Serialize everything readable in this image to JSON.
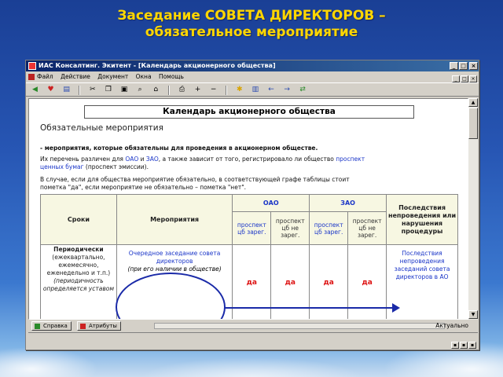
{
  "slide": {
    "title_line1": "Заседание СОВЕТА ДИРЕКТОРОВ –",
    "title_line2": "обязательное мероприятие"
  },
  "window": {
    "title": "ИАС Консалтинг. Экитент - [Календарь акционерного общества]",
    "controls": {
      "minimize": "_",
      "maximize": "□",
      "close": "×"
    }
  },
  "menu": {
    "items": [
      "Файл",
      "Действие",
      "Документ",
      "Окна",
      "Помощь"
    ]
  },
  "toolbar": {
    "icons": [
      "back-icon",
      "heart-icon",
      "bookmark-icon",
      "cut-icon",
      "copy-icon",
      "paste-icon",
      "find-icon",
      "home-icon",
      "print-icon",
      "zoom-in-icon",
      "zoom-out-icon",
      "lightbulb-icon",
      "chart-icon",
      "arrow-left-icon",
      "arrow-right-icon",
      "sync-icon"
    ]
  },
  "document": {
    "heading": "Календарь акционерного общества",
    "section_title": "Обязательные мероприятия",
    "intro_bold": "- мероприятия, которые обязательны для проведения в акционерном обществе.",
    "p1_a": "Их перечень различен для ",
    "p1_link1": "ОАО",
    "p1_b": " и ",
    "p1_link2": "ЗАО",
    "p1_c": ", а также зависит от того, регистрировало ли общество ",
    "p1_link3": "проспект",
    "p1_link3b": "ценных бумаг",
    "p1_d": " (проспект эмиссии).",
    "p2_line1": "В случае, если для общества мероприятие обязательно, в соответствующей графе таблицы стоит",
    "p2_line2": "пометка \"да\", если мероприятие не обязательно – пометка \"нет\"."
  },
  "table": {
    "headers": {
      "terms": "Сроки",
      "events": "Мероприятия",
      "oao": "ОАО",
      "zao": "ЗАО",
      "consequences": "Последствия непроведения или нарушения процедуры"
    },
    "subheaders": {
      "reg": "проспект цб зарег.",
      "notreg": "проспект цб не зарег."
    },
    "row1": {
      "term_bold": "Периодически",
      "term_detail": "(ежеквартально, ежемесячно, еженедельно и т.п.)",
      "term_note": "(периодичность определяется уставом",
      "event_title": "Очередное заседание совета директоров",
      "event_note": "(при его наличии в обществе)",
      "yes": "да",
      "consequence": "Последствия непроведения заседаний совета директоров в АО"
    }
  },
  "bottom": {
    "tab1": "Справка",
    "tab2": "Атрибуты",
    "status": "Актуально"
  },
  "colors": {
    "title": "#ffd700",
    "link": "#1a35c8",
    "yes": "#dd1111",
    "annotation": "#1a2aa8"
  }
}
